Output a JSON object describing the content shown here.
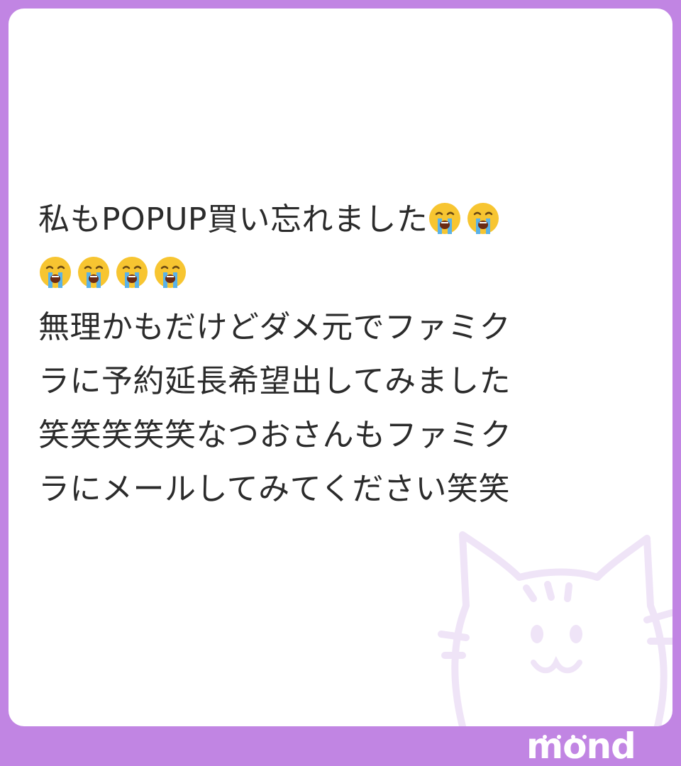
{
  "post": {
    "line1_text": "私もPOPUP買い忘れました",
    "line1_emoji_count": 2,
    "line2_emoji_count": 4,
    "emoji": "loudly-crying-face",
    "line3": "無理かもだけどダメ元でファミク",
    "line4": "ラに予約延長希望出してみました",
    "line5": "笑笑笑笑笑なつおさんもファミク",
    "line6": "ラにメールしてみてください笑笑"
  },
  "brand": {
    "logo_text": "mond"
  },
  "colors": {
    "frame": "#c185e3",
    "card": "#ffffff",
    "text": "#2b2b2b",
    "watermark": "#efe4f7"
  }
}
